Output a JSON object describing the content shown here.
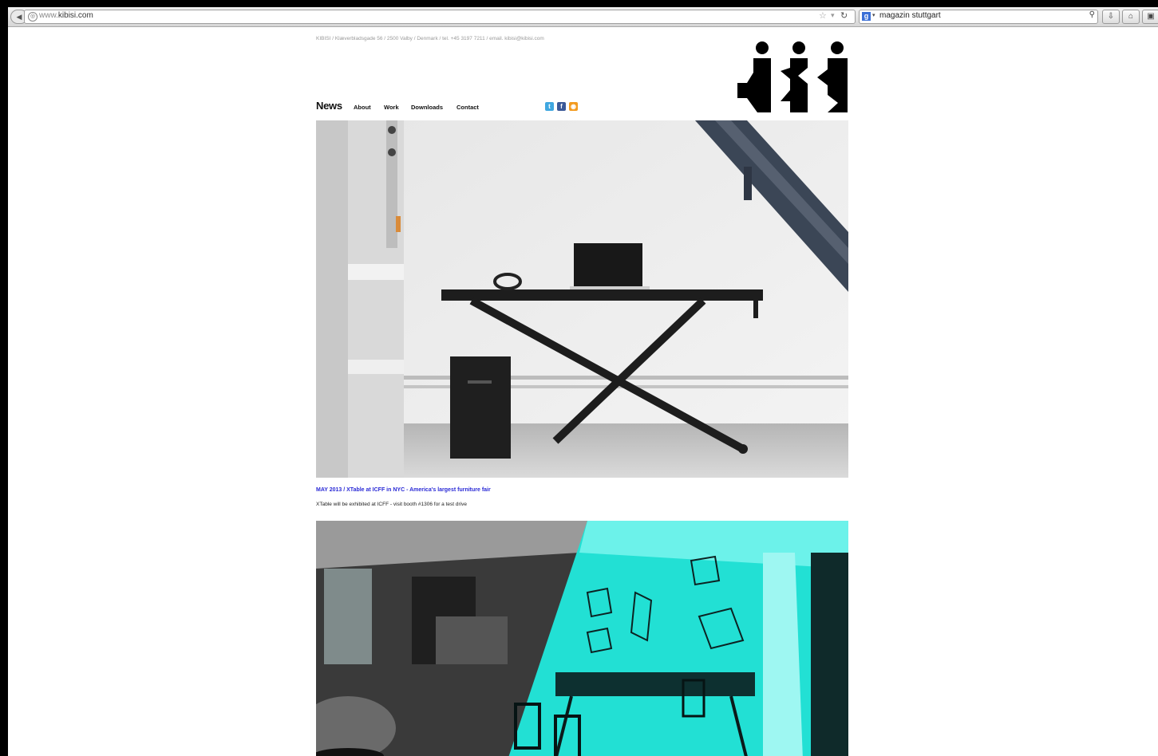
{
  "browser": {
    "url_prefix": "www.",
    "url_domain": "kibisi.com",
    "search_query": "magazin stuttgart"
  },
  "site": {
    "address": "KIBISI / Klæverbladsgade 56 / 2500 Valby / Denmark / tel. +45 3197 7211 / email. kibisi@kibisi.com",
    "nav": {
      "news": "News",
      "about": "About",
      "work": "Work",
      "downloads": "Downloads",
      "contact": "Contact"
    },
    "social": [
      "twitter-icon",
      "facebook-icon",
      "rss-icon"
    ],
    "news_items": [
      {
        "title": "MAY 2013 / XTable at ICFF in NYC - America's largest furniture fair",
        "body": "XTable will be exhibited at ICFF - visit booth #1306 for a test drive"
      }
    ]
  },
  "colors": {
    "link": "#2a2ad6",
    "accent_cyan": "#22e0d4",
    "logo": "#000000"
  }
}
